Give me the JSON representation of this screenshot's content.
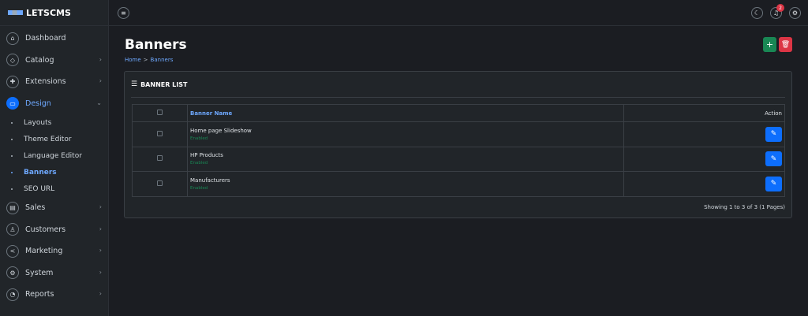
{
  "brand": {
    "name": "LETSCMS"
  },
  "sidebar": {
    "items": [
      {
        "label": "Dashboard",
        "icon": "home-icon",
        "has_children": false
      },
      {
        "label": "Catalog",
        "icon": "tag-icon",
        "has_children": true
      },
      {
        "label": "Extensions",
        "icon": "puzzle-icon",
        "has_children": true
      },
      {
        "label": "Design",
        "icon": "monitor-icon",
        "has_children": true,
        "active": true
      },
      {
        "label": "Sales",
        "icon": "cart-icon",
        "has_children": true
      },
      {
        "label": "Customers",
        "icon": "user-icon",
        "has_children": true
      },
      {
        "label": "Marketing",
        "icon": "share-icon",
        "has_children": true
      },
      {
        "label": "System",
        "icon": "gear-icon",
        "has_children": true
      },
      {
        "label": "Reports",
        "icon": "chart-icon",
        "has_children": true
      }
    ],
    "design_sub": [
      "Layouts",
      "Theme Editor",
      "Language Editor",
      "Banners",
      "SEO URL"
    ],
    "active_sub": "Banners"
  },
  "topbar": {
    "notification_count": "2"
  },
  "page": {
    "title": "Banners",
    "breadcrumb": [
      "Home",
      "Banners"
    ],
    "breadcrumb_sep": ">"
  },
  "card": {
    "title": "BANNER LIST",
    "columns": {
      "name": "Banner Name",
      "action": "Action"
    },
    "rows": [
      {
        "name": "Home page Slideshow",
        "status": "Enabled"
      },
      {
        "name": "HP Products",
        "status": "Enabled"
      },
      {
        "name": "Manufacturers",
        "status": "Enabled"
      }
    ],
    "pagination": "Showing 1 to 3 of 3 (1 Pages)"
  },
  "colors": {
    "accent": "#0d6efd",
    "success": "#198754",
    "danger": "#dc3545"
  }
}
